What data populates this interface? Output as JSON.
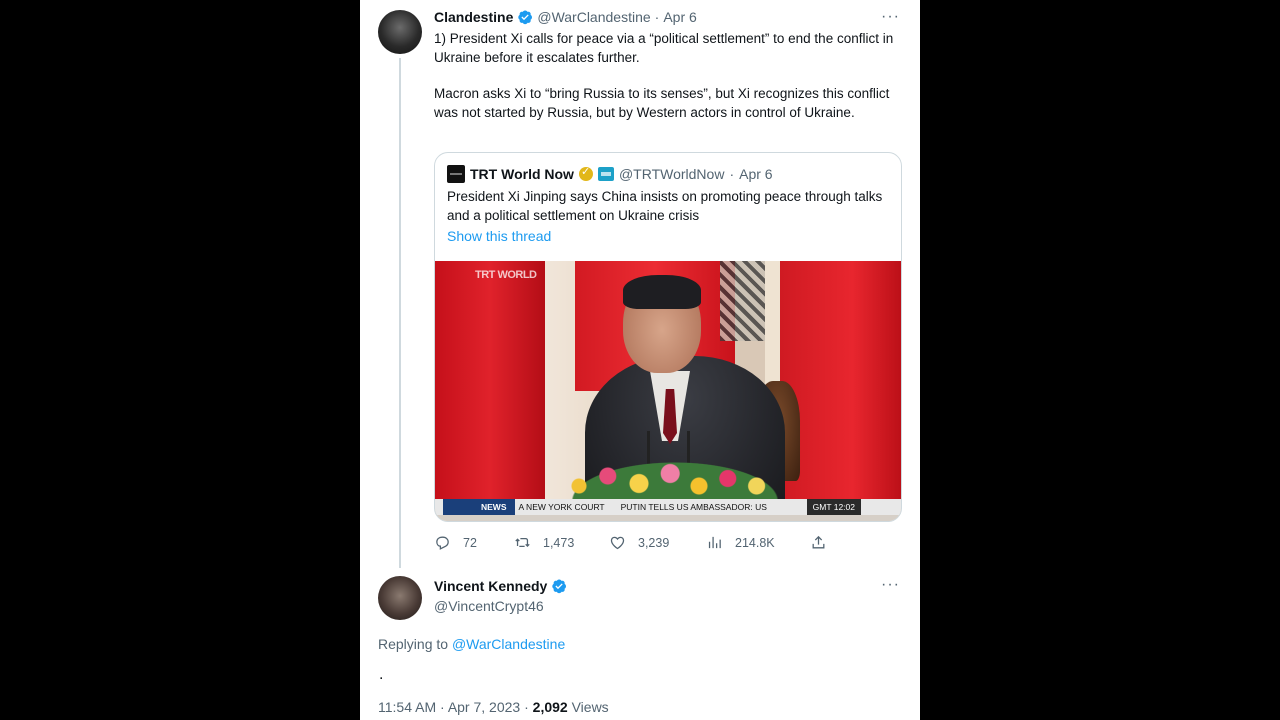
{
  "tweet": {
    "author_name": "Clandestine",
    "handle": "@WarClandestine",
    "separator": "·",
    "date": "Apr 6",
    "text_p1": "1) President Xi calls for peace via a “political settlement” to end the conflict in Ukraine before it escalates further.",
    "text_p2": "Macron asks Xi to “bring Russia to its senses”, but Xi recognizes this conflict was not started by Russia, but by Western actors in control of Ukraine.",
    "more_icon": "···"
  },
  "quote": {
    "author_name": "TRT World Now",
    "handle": "@TRTWorldNow",
    "separator": "·",
    "date": "Apr 6",
    "text": "President Xi Jinping says China insists on promoting peace through talks and a political settlement on Ukraine crisis",
    "show_thread": "Show this thread",
    "video": {
      "watermark": "TRT WORLD",
      "ticker_label": "NEWS",
      "ticker_story1": "A NEW YORK COURT",
      "ticker_story2": "PUTIN TELLS US AMBASSADOR: US",
      "ticker_clock": "GMT 12:02"
    }
  },
  "actions": {
    "replies": "72",
    "retweets": "1,473",
    "likes": "3,239",
    "views": "214.8K"
  },
  "reply": {
    "author_name": "Vincent Kennedy",
    "handle": "@VincentCrypt46",
    "replying_prefix": "Replying to",
    "replying_to": "@WarClandestine",
    "text": ".",
    "time": "11:54 AM",
    "separator": "·",
    "date": "Apr 7, 2023",
    "views_count": "2,092",
    "views_label": "Views",
    "more_icon": "···"
  },
  "colors": {
    "accent": "#1d9bf0",
    "text_primary": "#0f1419",
    "text_secondary": "#536471",
    "border": "#cfd9de"
  }
}
